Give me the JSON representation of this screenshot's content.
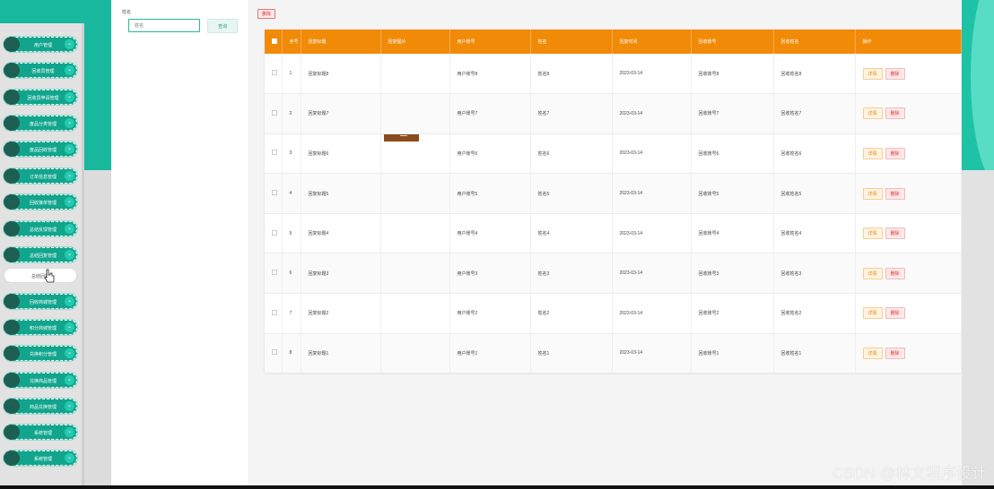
{
  "sidebar": {
    "items": [
      {
        "label": "用户管理",
        "state": "collapsed"
      },
      {
        "label": "回收员管理",
        "state": "collapsed"
      },
      {
        "label": "回收员申请管理",
        "state": "collapsed"
      },
      {
        "label": "废品分类管理",
        "state": "collapsed"
      },
      {
        "label": "废品回收管理",
        "state": "collapsed"
      },
      {
        "label": "订单信息管理",
        "state": "collapsed"
      },
      {
        "label": "回收接单管理",
        "state": "collapsed"
      },
      {
        "label": "总结反馈管理",
        "state": "collapsed"
      },
      {
        "label": "总结回复管理",
        "state": "collapsed"
      },
      {
        "label": "总结回复",
        "state": "active"
      },
      {
        "label": "回收商城管理",
        "state": "collapsed"
      },
      {
        "label": "积分商城管理",
        "state": "collapsed"
      },
      {
        "label": "兑换积分管理",
        "state": "collapsed"
      },
      {
        "label": "兑换商品管理",
        "state": "collapsed"
      },
      {
        "label": "商品兑换管理",
        "state": "collapsed"
      },
      {
        "label": "系统管理",
        "state": "collapsed"
      },
      {
        "label": "系统管理",
        "state": "collapsed"
      }
    ]
  },
  "search": {
    "label": "姓名",
    "placeholder": "姓名",
    "button_label": "查询"
  },
  "toolbar": {
    "delete_label": "删除"
  },
  "table": {
    "columns": [
      "",
      "序号",
      "回复标题",
      "回复图片",
      "用户账号",
      "姓名",
      "回复时间",
      "回收账号",
      "回收姓名",
      "操作"
    ],
    "rows": [
      {
        "index": "1",
        "title": "回复标题8",
        "image": "",
        "user_account": "用户账号8",
        "name": "姓名8",
        "time": "2023-03-14",
        "recycle_account": "回收账号8",
        "recycle_name": "回收姓名8"
      },
      {
        "index": "2",
        "title": "回复标题7",
        "image": "",
        "user_account": "用户账号7",
        "name": "姓名7",
        "time": "2023-03-14",
        "recycle_account": "回收账号7",
        "recycle_name": "回收姓名7"
      },
      {
        "index": "3",
        "title": "回复标题6",
        "image": "",
        "user_account": "用户账号6",
        "name": "姓名6",
        "time": "2023-03-14",
        "recycle_account": "回收账号6",
        "recycle_name": "回收姓名6"
      },
      {
        "index": "4",
        "title": "回复标题5",
        "image": "",
        "user_account": "用户账号5",
        "name": "姓名5",
        "time": "2023-03-14",
        "recycle_account": "回收账号5",
        "recycle_name": "回收姓名5"
      },
      {
        "index": "5",
        "title": "回复标题4",
        "image": "",
        "user_account": "用户账号4",
        "name": "姓名4",
        "time": "2023-03-14",
        "recycle_account": "回收账号4",
        "recycle_name": "回收姓名4"
      },
      {
        "index": "6",
        "title": "回复标题3",
        "image": "",
        "user_account": "用户账号3",
        "name": "姓名3",
        "time": "2023-03-14",
        "recycle_account": "回收账号3",
        "recycle_name": "回收姓名3"
      },
      {
        "index": "7",
        "title": "回复标题2",
        "image": "",
        "user_account": "用户账号2",
        "name": "姓名2",
        "time": "2023-03-14",
        "recycle_account": "回收账号2",
        "recycle_name": "回收姓名2"
      },
      {
        "index": "8",
        "title": "回复标题1",
        "image": "",
        "user_account": "用户账号1",
        "name": "姓名1",
        "time": "2023-03-14",
        "recycle_account": "回收账号1",
        "recycle_name": "回收姓名1"
      }
    ],
    "action_detail": "详情",
    "action_delete": "删除"
  },
  "icons": {
    "menu_chevron": "chevron-down-icon",
    "cursor": "hand-cursor-icon"
  },
  "colors": {
    "teal": "#17b89e",
    "menu_green": "#12a58d",
    "header_orange": "#f18a07",
    "danger": "#dd3333"
  },
  "watermark": "CSDN @林文程序设计"
}
